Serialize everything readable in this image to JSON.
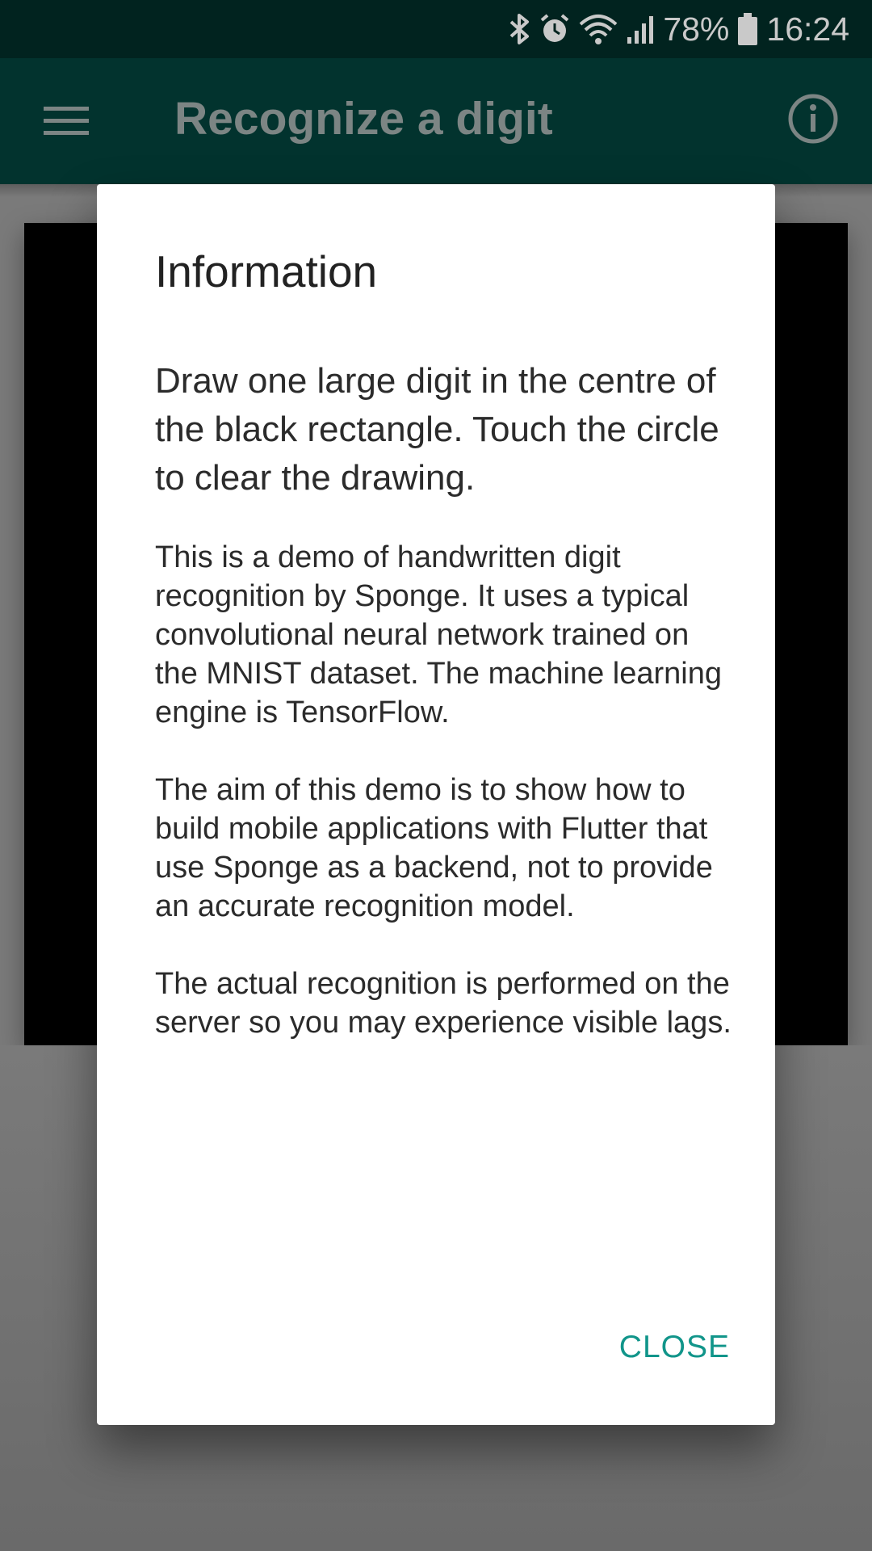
{
  "status_bar": {
    "battery": "78%",
    "time": "16:24",
    "icons": [
      "bluetooth-icon",
      "alarm-icon",
      "wifi-icon",
      "signal-icon",
      "battery-icon"
    ]
  },
  "app_bar": {
    "title": "Recognize a digit",
    "menu_icon": "menu-icon",
    "info_icon": "info-icon"
  },
  "dialog": {
    "title": "Information",
    "lead": "Draw one large digit in the centre of the black rectangle. Touch the circle to clear the drawing.",
    "paragraphs": [
      "This is a demo of handwritten digit recognition by Sponge. It uses a typical convolutional neural network trained on the MNIST dataset. The machine learning engine is TensorFlow.",
      "The aim of this demo is to show how to build mobile applications with Flutter that use Sponge as a backend, not to provide an accurate recognition model.",
      "The actual recognition is performed on the server so you may experience visible lags."
    ],
    "close_label": "CLOSE"
  },
  "colors": {
    "status_bar": "#01231f",
    "app_bar": "#02332e",
    "accent": "#11958a",
    "scrim": "#7a7a7a",
    "canvas": "#000000"
  }
}
